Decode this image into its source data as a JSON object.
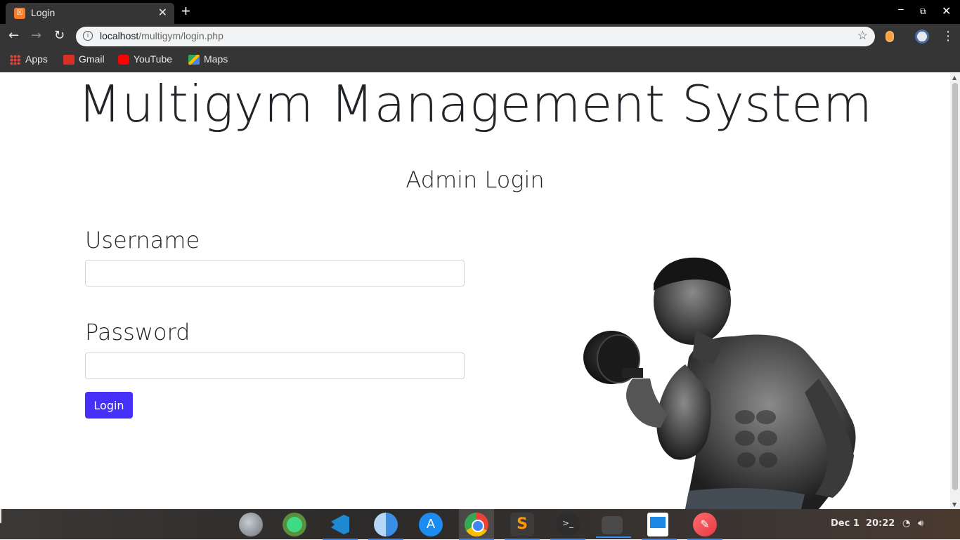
{
  "browser": {
    "tab_title": "Login",
    "tab_close": "✕",
    "new_tab": "+",
    "url_host": "localhost",
    "url_path": "/multigym/login.php",
    "window_controls": {
      "minimize": "–",
      "maximize": "⧉",
      "close": "✕"
    },
    "bookmarks": [
      "Apps",
      "Gmail",
      "YouTube",
      "Maps"
    ]
  },
  "page": {
    "title": "Multigym Management System",
    "subtitle": "Admin Login",
    "username_label": "Username",
    "username_value": "",
    "password_label": "Password",
    "password_value": "",
    "login_button": "Login"
  },
  "taskbar": {
    "date": "Dec 1",
    "time": "20:22",
    "apps": [
      "launchpad",
      "android-studio",
      "vscode",
      "finder",
      "app-store",
      "chrome",
      "sublime-text",
      "terminal",
      "files",
      "libreoffice-writer",
      "drawing"
    ]
  },
  "colors": {
    "primary_button": "#4530fa",
    "browser_chrome": "#353535",
    "title_text": "#212529"
  }
}
